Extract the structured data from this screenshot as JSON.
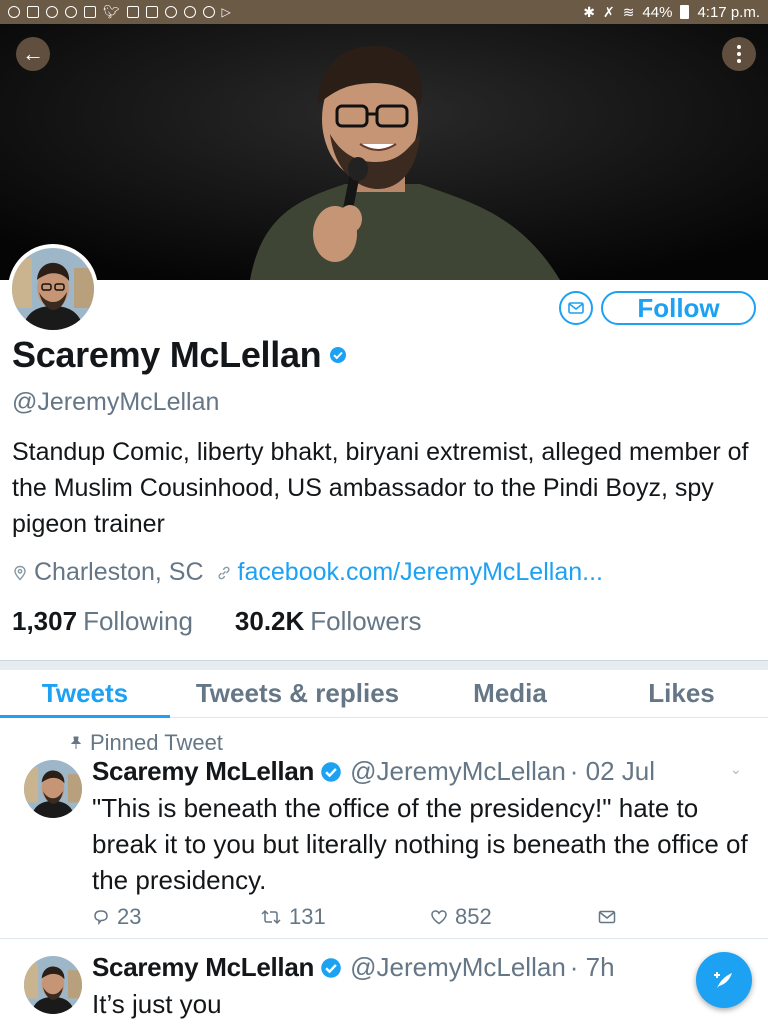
{
  "status_bar": {
    "battery": "44%",
    "time": "4:17 p.m."
  },
  "profile": {
    "display_name": "Scaremy McLellan",
    "handle": "@JeremyMcLellan",
    "bio": "Standup Comic, liberty bhakt, biryani extremist, alleged member of the Muslim Cousinhood, US ambassador to the Pindi Boyz, spy pigeon trainer",
    "location": "Charleston, SC",
    "website": "facebook.com/JeremyMcLellan...",
    "following_count": "1,307",
    "following_label": "Following",
    "followers_count": "30.2K",
    "followers_label": "Followers",
    "follow_label": "Follow",
    "verified": true
  },
  "tabs": [
    {
      "label": "Tweets",
      "active": true
    },
    {
      "label": "Tweets & replies",
      "active": false
    },
    {
      "label": "Media",
      "active": false
    },
    {
      "label": "Likes",
      "active": false
    }
  ],
  "tweets": [
    {
      "pinned_label": "Pinned Tweet",
      "name": "Scaremy McLellan",
      "handle": "@JeremyMcLellan",
      "time": "· 02 Jul",
      "text": "\"This is beneath the office of the presidency!\" hate to break it to you but literally nothing is beneath the office of the presidency.",
      "replies": "23",
      "retweets": "131",
      "likes": "852"
    },
    {
      "name": "Scaremy McLellan",
      "handle": "@JeremyMcLellan",
      "time": "· 7h",
      "text": "It’s just you"
    }
  ],
  "colors": {
    "accent": "#1da1f2",
    "secondary_text": "#657786",
    "status_bar": "#6b5a45"
  }
}
